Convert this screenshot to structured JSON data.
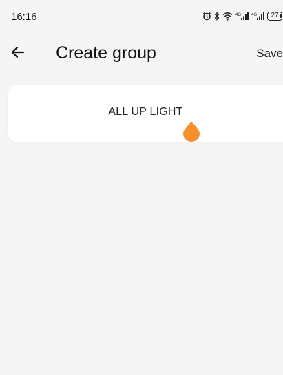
{
  "status_bar": {
    "time": "16:16",
    "icons": [
      "alarm-icon",
      "bluetooth-icon",
      "wifi-icon",
      "signal-icon",
      "signal-icon"
    ],
    "battery": "27"
  },
  "app_bar": {
    "back_icon": "arrow-left-icon",
    "title": "Create group",
    "save_label": "Save"
  },
  "group": {
    "name_value": "ALL UP LIGHT"
  },
  "colors": {
    "background": "#f5f5f5",
    "card": "#ffffff",
    "cursor_handle": "#f78f2e",
    "text": "#111111"
  }
}
